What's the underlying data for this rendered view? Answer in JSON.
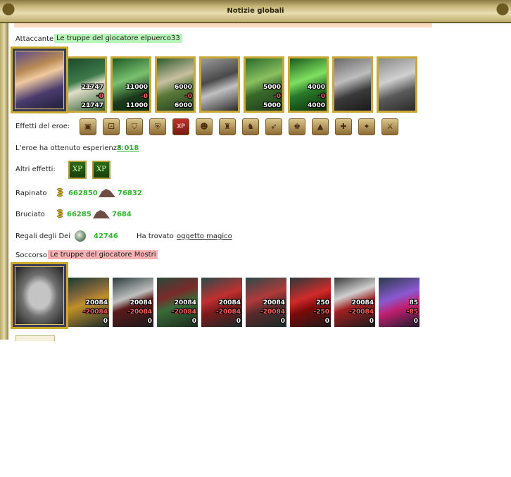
{
  "window": {
    "title": "Notizie globali"
  },
  "attacker": {
    "label": "Attaccante",
    "tag": "Le truppe del giocatore elpuerco33",
    "units": [
      {
        "n1": "21747",
        "n2": "-0",
        "n3": "21747",
        "name": "dwarf-unit"
      },
      {
        "n1": "11000",
        "n2": "-0",
        "n3": "11000",
        "name": "elf-swordsman-unit"
      },
      {
        "n1": "6000",
        "n2": "-0",
        "n3": "6000",
        "name": "paladin-unit"
      },
      {
        "n1": "",
        "n2": "",
        "n3": "",
        "name": "griffin-unit"
      },
      {
        "n1": "5000",
        "n2": "-0",
        "n3": "5000",
        "name": "archer-unit"
      },
      {
        "n1": "4000",
        "n2": "-0",
        "n3": "4000",
        "name": "druid-unit"
      },
      {
        "n1": "",
        "n2": "",
        "n3": "",
        "name": "armored-knight-unit"
      },
      {
        "n1": "",
        "n2": "",
        "n3": "",
        "name": "statue-unit"
      }
    ]
  },
  "hero_effects": {
    "label": "Effetti del eroe:",
    "icons": [
      "chest-icon",
      "dice-icon",
      "shield-icon",
      "shield-sword-icon",
      "xp-icon",
      "xp-goblin-icon",
      "bag-icon",
      "beast-icon",
      "arrow-icon",
      "wizard-icon",
      "tent-icon",
      "catapult-icon",
      "scroll-icon",
      "sword-icon"
    ]
  },
  "experience": {
    "label": "L'eroe ha ottenuto esperienza:",
    "value": "3 018"
  },
  "other_effects": {
    "label": "Altri effetti:",
    "xp1": "XP",
    "xp2": "XP"
  },
  "robbed": {
    "label": "Rapinato",
    "gold": "662850",
    "ore": "76832"
  },
  "burned": {
    "label": "Bruciato",
    "gold": "66285",
    "ore": "7684"
  },
  "gifts": {
    "label": "Regali degli Dei",
    "value": "42746",
    "found_label": "Ha trovato",
    "found_link": "oggetto magico"
  },
  "rescue": {
    "label": "Soccorso",
    "tag": "Le truppe del giocatore Mostri",
    "units": [
      {
        "n1": "20084",
        "n2": "-20084",
        "n3": "0",
        "name": "orc-warlord-unit"
      },
      {
        "n1": "20084",
        "n2": "-20084",
        "n3": "0",
        "name": "dark-knight-unit"
      },
      {
        "n1": "20084",
        "n2": "-20084",
        "n3": "0",
        "name": "goblin-unit"
      },
      {
        "n1": "20084",
        "n2": "-20084",
        "n3": "0",
        "name": "demon-unit"
      },
      {
        "n1": "20084",
        "n2": "-20084",
        "n3": "0",
        "name": "spider-demon-unit"
      },
      {
        "n1": "250",
        "n2": "-250",
        "n3": "0",
        "name": "red-dragon-unit"
      },
      {
        "n1": "20084",
        "n2": "-20084",
        "n3": "0",
        "name": "bone-tower-unit"
      },
      {
        "n1": "85",
        "n2": "-85",
        "n3": "0",
        "name": "hydra-unit"
      }
    ]
  },
  "colors": {
    "green_value": "#2fb52f",
    "loss_red": "#ff6060",
    "frame_gold": "#caa838"
  }
}
